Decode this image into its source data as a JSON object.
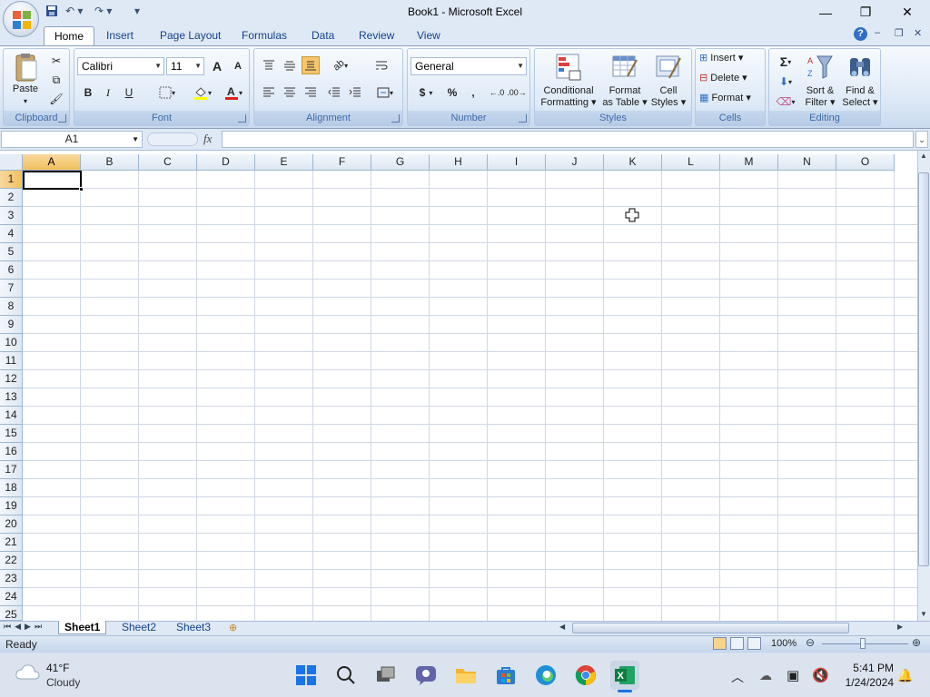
{
  "window": {
    "title": "Book1 - Microsoft Excel"
  },
  "tabs": [
    "Home",
    "Insert",
    "Page Layout",
    "Formulas",
    "Data",
    "Review",
    "View"
  ],
  "ribbon": {
    "clipboard": {
      "label": "Clipboard",
      "paste": "Paste"
    },
    "font": {
      "label": "Font",
      "name": "Calibri",
      "size": "11",
      "bold": "B",
      "italic": "I",
      "underline": "U",
      "grow": "A",
      "shrink": "A"
    },
    "alignment": {
      "label": "Alignment"
    },
    "number": {
      "label": "Number",
      "format": "General",
      "currency": "$",
      "percent": "%",
      "comma": ","
    },
    "styles": {
      "label": "Styles",
      "conditional_1": "Conditional",
      "conditional_2": "Formatting",
      "format_table_1": "Format",
      "format_table_2": "as Table",
      "cell_styles_1": "Cell",
      "cell_styles_2": "Styles"
    },
    "cells": {
      "label": "Cells",
      "insert": "Insert",
      "delete": "Delete",
      "format": "Format"
    },
    "editing": {
      "label": "Editing",
      "sigma": "Σ",
      "sort_1": "Sort &",
      "sort_2": "Filter",
      "find_1": "Find &",
      "find_2": "Select"
    }
  },
  "formula_bar": {
    "name_box": "A1",
    "fx": "fx",
    "content": ""
  },
  "columns": [
    "A",
    "B",
    "C",
    "D",
    "E",
    "F",
    "G",
    "H",
    "I",
    "J",
    "K",
    "L",
    "M",
    "N",
    "O"
  ],
  "rows": [
    "1",
    "2",
    "3",
    "4",
    "5",
    "6",
    "7",
    "8",
    "9",
    "10",
    "11",
    "12",
    "13",
    "14",
    "15",
    "16",
    "17",
    "18",
    "19",
    "20",
    "21",
    "22",
    "23",
    "24",
    "25"
  ],
  "sheets": [
    "Sheet1",
    "Sheet2",
    "Sheet3"
  ],
  "status": {
    "text": "Ready",
    "zoom": "100%"
  },
  "taskbar": {
    "temperature": "41°F",
    "weather": "Cloudy",
    "time": "5:41 PM",
    "date": "1/24/2024"
  },
  "colors": {
    "accent": "#15428b",
    "ribbon_bg": "#dfe9f5",
    "selected_header": "#f1c05c"
  }
}
